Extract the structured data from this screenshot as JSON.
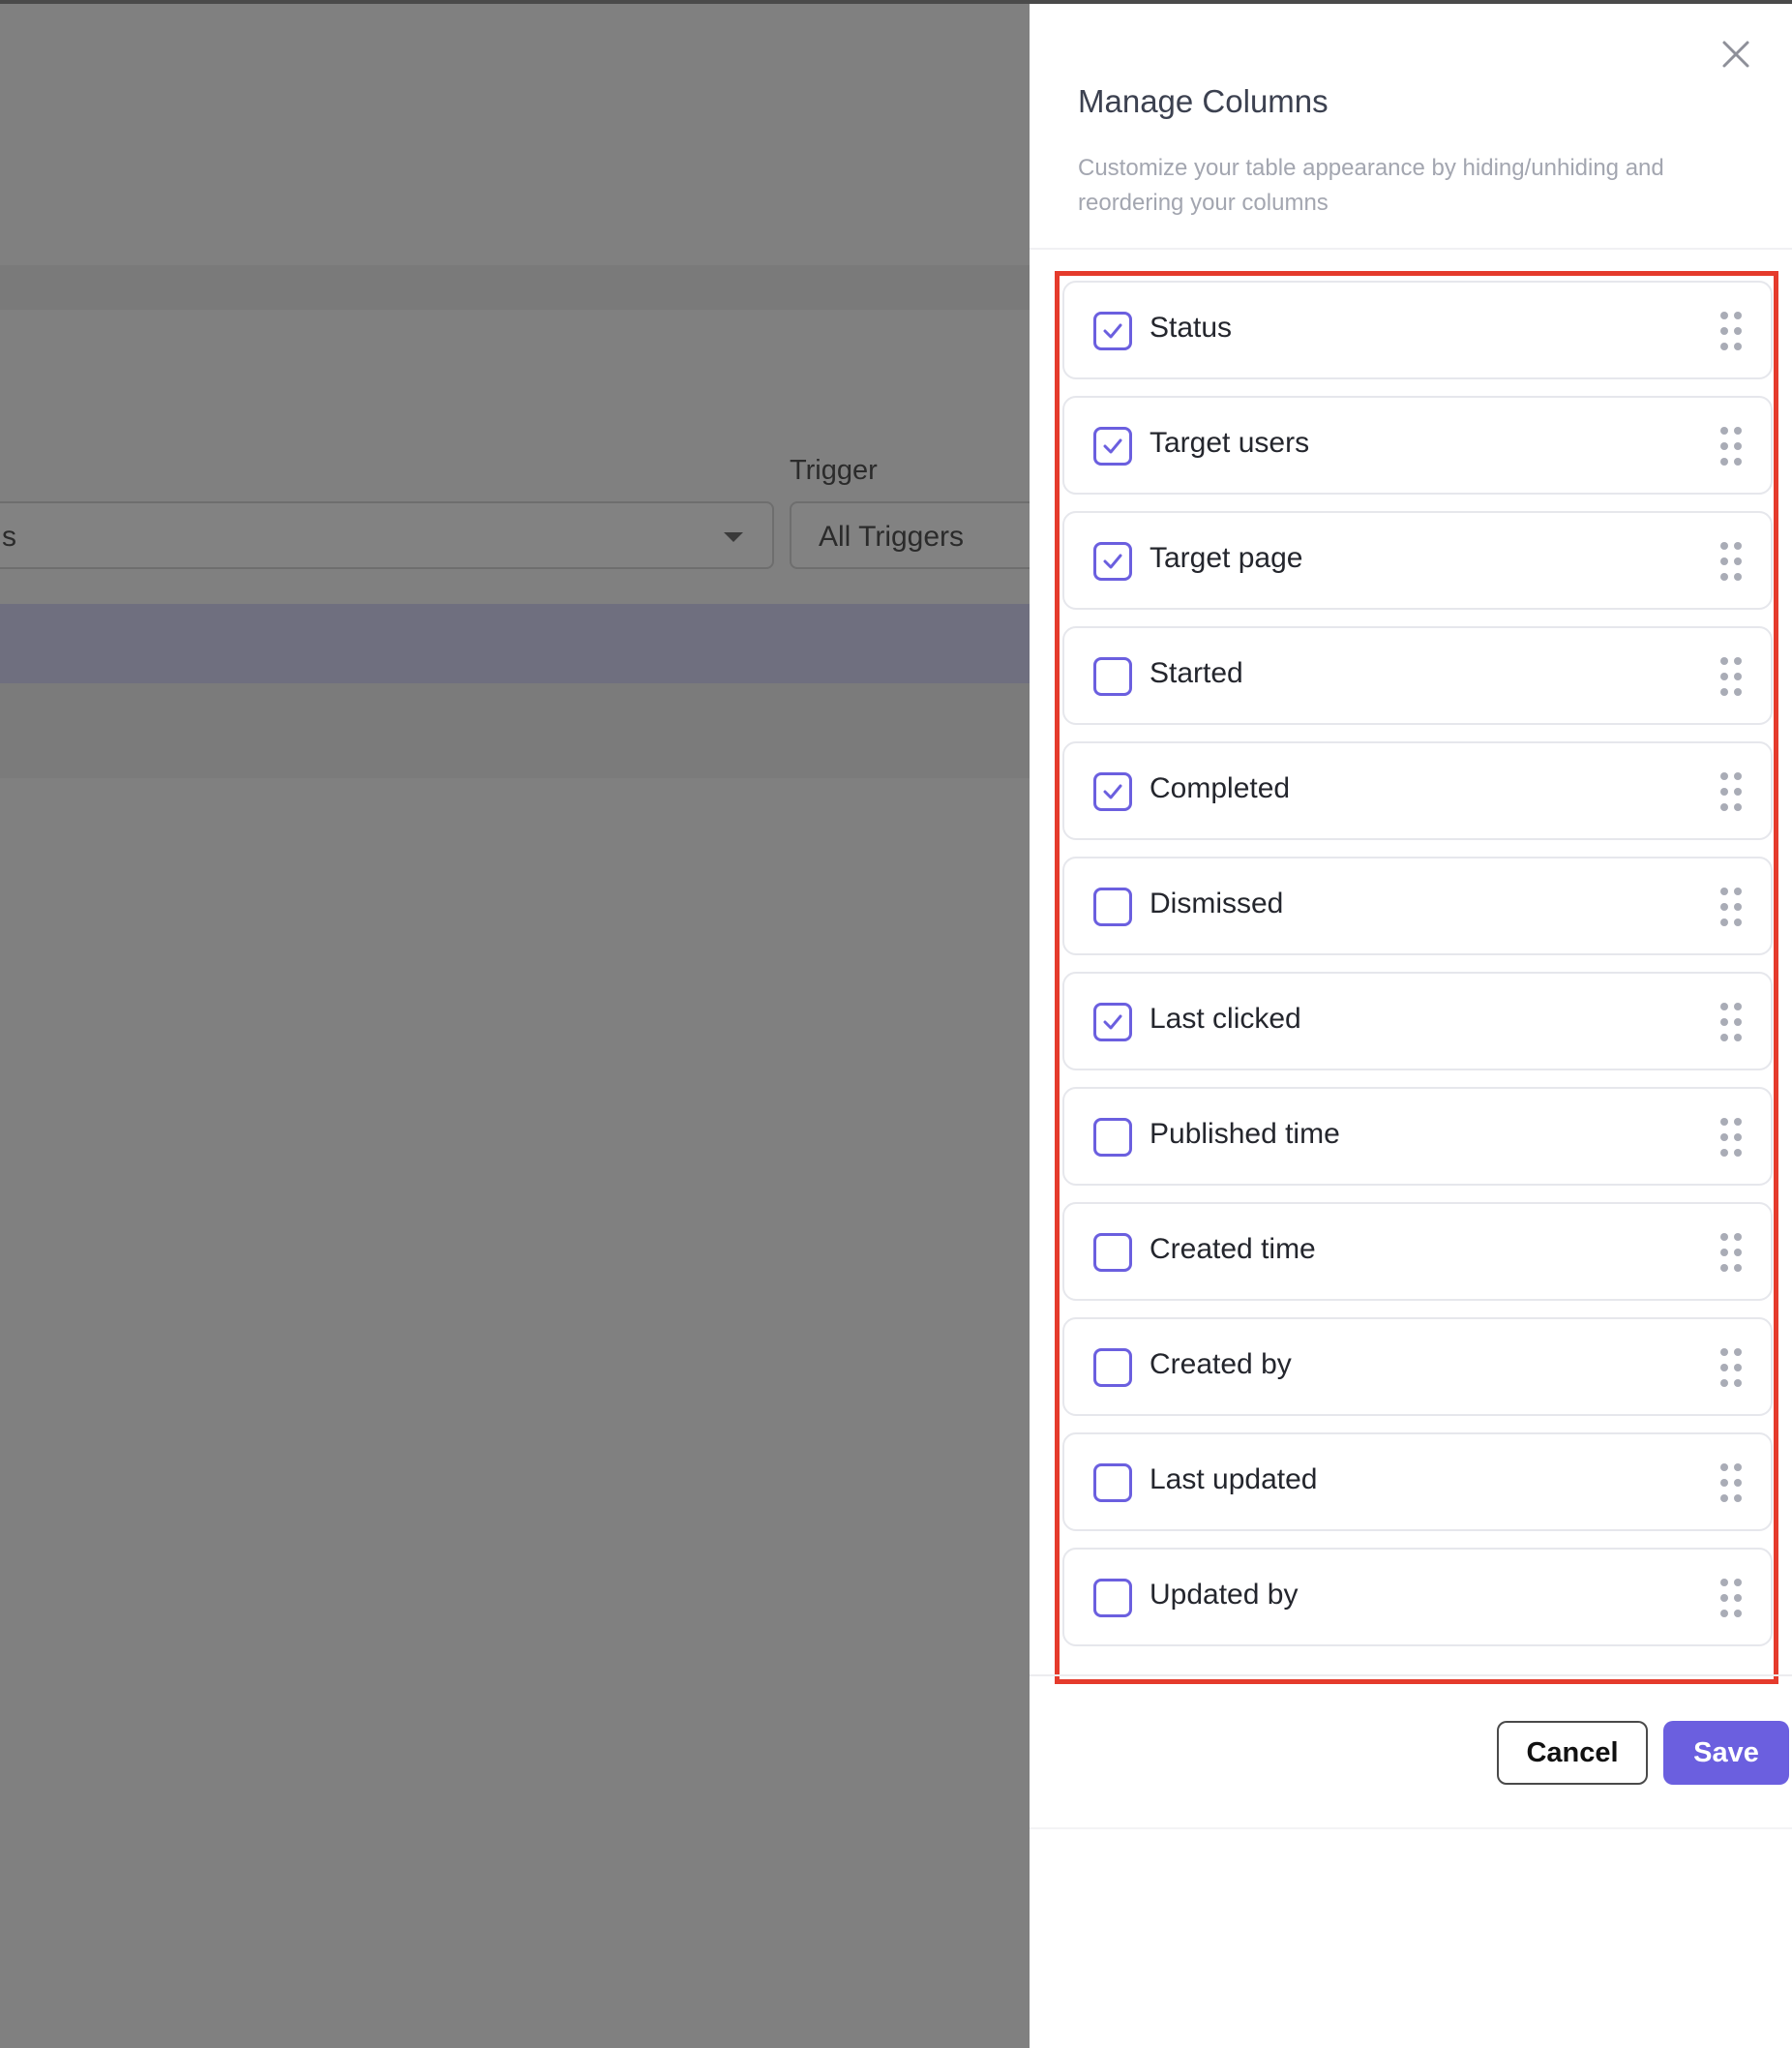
{
  "background": {
    "trigger_label": "Trigger",
    "filter_select_value": "s",
    "trigger_select_value": "All Triggers"
  },
  "drawer": {
    "title": "Manage Columns",
    "description": "Customize your table appearance by hiding/unhiding and reordering your columns",
    "close_icon": "close-icon",
    "columns": [
      {
        "label": "Status",
        "checked": true
      },
      {
        "label": "Target users",
        "checked": true
      },
      {
        "label": "Target page",
        "checked": true
      },
      {
        "label": "Started",
        "checked": false
      },
      {
        "label": "Completed",
        "checked": true
      },
      {
        "label": "Dismissed",
        "checked": false
      },
      {
        "label": "Last clicked",
        "checked": true
      },
      {
        "label": "Published time",
        "checked": false
      },
      {
        "label": "Created time",
        "checked": false
      },
      {
        "label": "Created by",
        "checked": false
      },
      {
        "label": "Last updated",
        "checked": false
      },
      {
        "label": "Updated by",
        "checked": false
      }
    ],
    "cancel_label": "Cancel",
    "save_label": "Save"
  },
  "colors": {
    "accent": "#6b5fdf",
    "highlight": "#e53b2c",
    "overlay": "#808080"
  }
}
